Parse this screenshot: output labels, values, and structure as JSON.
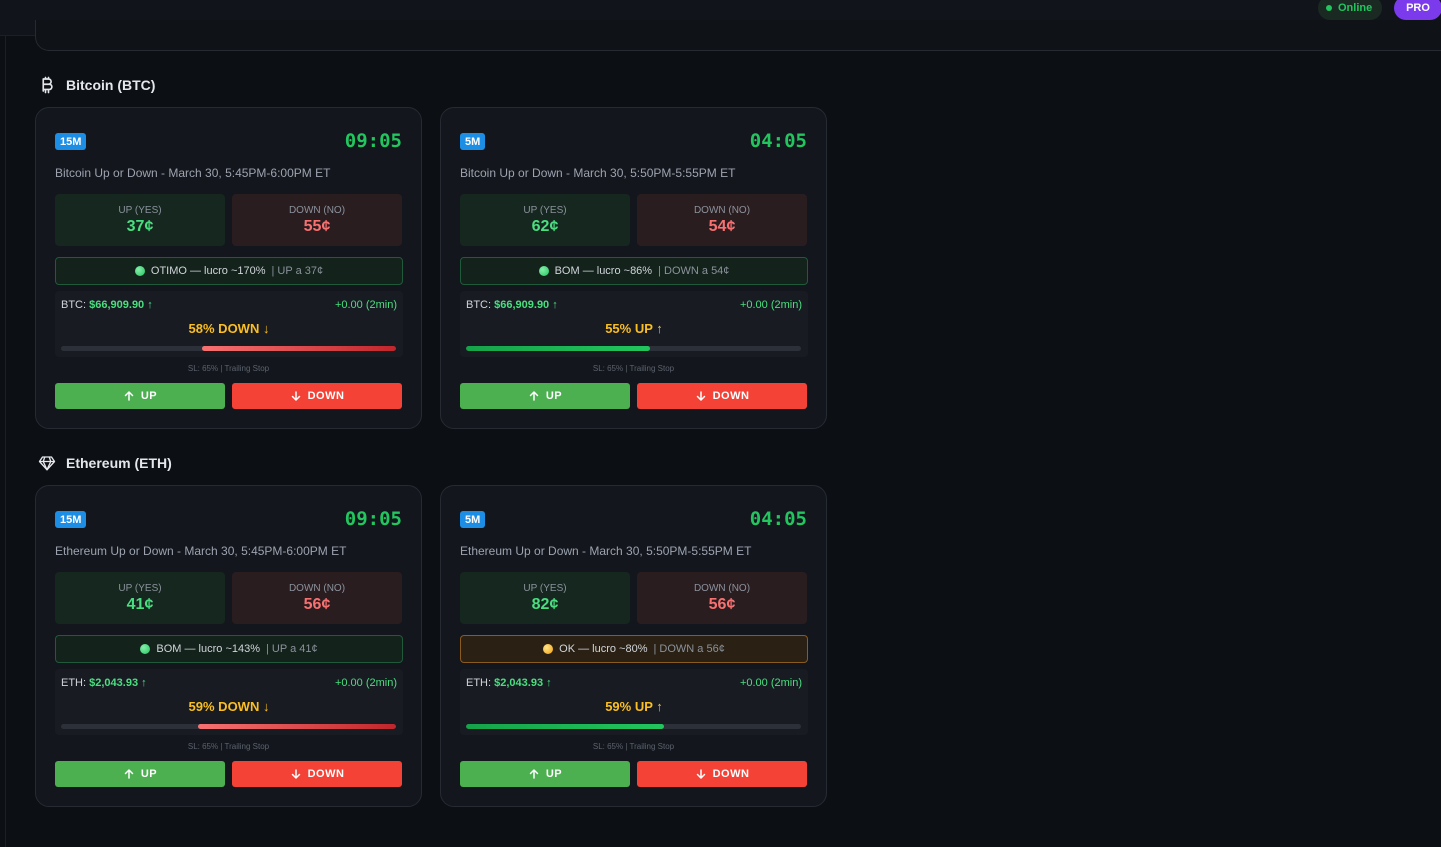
{
  "topbar": {
    "status": "Online",
    "plan": "PRO"
  },
  "sections": [
    {
      "title": "Bitcoin (BTC)",
      "icon": "bitcoin-icon",
      "cards": [
        {
          "timeframe": "15M",
          "timer": "09:05",
          "title": "Bitcoin Up or Down - March 30, 5:45PM-6:00PM ET",
          "up_label": "UP (YES)",
          "up_price": "37¢",
          "down_label": "DOWN (NO)",
          "down_price": "55¢",
          "signal_main": "OTIMO — lucro ~170%",
          "signal_sub": "| UP a 37¢",
          "signal_tone": "good",
          "asset_label": "BTC:",
          "asset_price": "$66,909.90 ↑",
          "change": "+0.00 (2min)",
          "prediction": "58% DOWN ↓",
          "prediction_dir": "down",
          "prediction_pct": 58,
          "sl": "SL: 65% | Trailing Stop",
          "up_button": "UP",
          "down_button": "DOWN"
        },
        {
          "timeframe": "5M",
          "timer": "04:05",
          "title": "Bitcoin Up or Down - March 30, 5:50PM-5:55PM ET",
          "up_label": "UP (YES)",
          "up_price": "62¢",
          "down_label": "DOWN (NO)",
          "down_price": "54¢",
          "signal_main": "BOM — lucro ~86%",
          "signal_sub": "| DOWN a 54¢",
          "signal_tone": "good",
          "asset_label": "BTC:",
          "asset_price": "$66,909.90 ↑",
          "change": "+0.00 (2min)",
          "prediction": "55% UP ↑",
          "prediction_dir": "up",
          "prediction_pct": 55,
          "sl": "SL: 65% | Trailing Stop",
          "up_button": "UP",
          "down_button": "DOWN"
        }
      ]
    },
    {
      "title": "Ethereum (ETH)",
      "icon": "diamond-icon",
      "cards": [
        {
          "timeframe": "15M",
          "timer": "09:05",
          "title": "Ethereum Up or Down - March 30, 5:45PM-6:00PM ET",
          "up_label": "UP (YES)",
          "up_price": "41¢",
          "down_label": "DOWN (NO)",
          "down_price": "56¢",
          "signal_main": "BOM — lucro ~143%",
          "signal_sub": "| UP a 41¢",
          "signal_tone": "good",
          "asset_label": "ETH:",
          "asset_price": "$2,043.93 ↑",
          "change": "+0.00 (2min)",
          "prediction": "59% DOWN ↓",
          "prediction_dir": "down",
          "prediction_pct": 59,
          "sl": "SL: 65% | Trailing Stop",
          "up_button": "UP",
          "down_button": "DOWN"
        },
        {
          "timeframe": "5M",
          "timer": "04:05",
          "title": "Ethereum Up or Down - March 30, 5:50PM-5:55PM ET",
          "up_label": "UP (YES)",
          "up_price": "82¢",
          "down_label": "DOWN (NO)",
          "down_price": "56¢",
          "signal_main": "OK — lucro ~80%",
          "signal_sub": "| DOWN a 56¢",
          "signal_tone": "warn",
          "asset_label": "ETH:",
          "asset_price": "$2,043.93 ↑",
          "change": "+0.00 (2min)",
          "prediction": "59% UP ↑",
          "prediction_dir": "up",
          "prediction_pct": 59,
          "sl": "SL: 65% | Trailing Stop",
          "up_button": "UP",
          "down_button": "DOWN"
        }
      ]
    }
  ]
}
